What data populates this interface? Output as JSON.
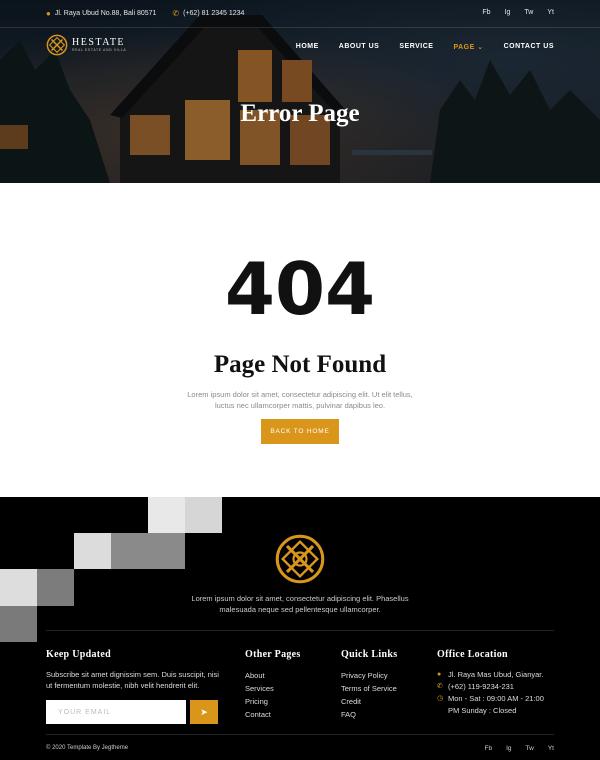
{
  "topbar": {
    "address": "Jl. Raya Ubud No.88, Bali 80571",
    "phone": "(+62) 81 2345 1234",
    "socials": [
      "Fb",
      "Ig",
      "Tw",
      "Yt"
    ]
  },
  "brand": {
    "name": "HESTATE",
    "tagline": "REAL ESTATE AND VILLA"
  },
  "nav": {
    "items": [
      "HOME",
      "ABOUT US",
      "SERVICE",
      "PAGE",
      "CONTACT US"
    ],
    "active": "PAGE"
  },
  "hero": {
    "title": "Error Page"
  },
  "error": {
    "code": "404",
    "heading": "Page Not Found",
    "description": "Lorem ipsum dolor sit amet, consectetur adipiscing elit. Ut elit tellus, luctus nec ullamcorper mattis, pulvinar dapibus leo.",
    "button": "BACK TO HOME"
  },
  "footer": {
    "description": "Lorem ipsum dolor sit amet, consectetur adipiscing elit. Phasellus malesuada neque sed pellentesque ullamcorper.",
    "keep_updated": {
      "title": "Keep Updated",
      "text": "Subscribe sit amet dignissim sem. Duis suscipit, nisi ut fermentum molestie, nibh velit hendrerit elit.",
      "email_placeholder": "YOUR EMAIL"
    },
    "other_pages": {
      "title": "Other Pages",
      "items": [
        "About",
        "Services",
        "Pricing",
        "Contact"
      ]
    },
    "quick_links": {
      "title": "Quick Links",
      "items": [
        "Privacy Policy",
        "Terms of Service",
        "Credit",
        "FAQ"
      ]
    },
    "office": {
      "title": "Office Location",
      "address": "Jl. Raya Mas Ubud, Gianyar.",
      "phone": "(+62) 119-9234-231",
      "hours": "Mon - Sat : 09:00 AM - 21:00 PM Sunday : Closed"
    },
    "copyright": "© 2020 Template By Jegtheme",
    "socials": [
      "Fb",
      "Ig",
      "Tw",
      "Yt"
    ]
  },
  "colors": {
    "accent": "#d9961b",
    "dark": "#000000"
  }
}
